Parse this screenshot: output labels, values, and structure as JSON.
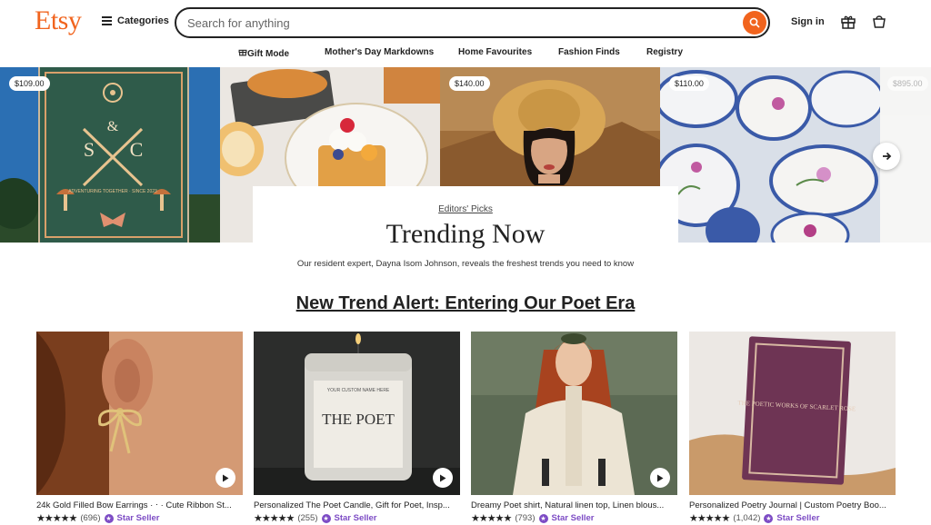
{
  "header": {
    "logo": "Etsy",
    "categories_label": "Categories",
    "search_placeholder": "Search for anything",
    "signin_label": "Sign in"
  },
  "nav": {
    "items": [
      {
        "label": "Gift Mode"
      },
      {
        "label": "Mother's Day Markdowns"
      },
      {
        "label": "Home Favourites"
      },
      {
        "label": "Fashion Finds"
      },
      {
        "label": "Registry"
      }
    ]
  },
  "hero": {
    "prices": [
      "$109.00",
      "$140.00",
      "$110.00",
      "$895.00"
    ],
    "eyebrow": "Editors' Picks",
    "title": "Trending Now",
    "description": "Our resident expert, Dayna Isom Johnson, reveals the freshest trends you need to know",
    "tapestry_text": "ADVENTURING TOGETHER · SINCE 2023"
  },
  "trend_heading": "New Trend Alert: Entering Our Poet Era",
  "products": [
    {
      "title": "24k Gold Filled Bow Earrings · ⋅ · Cute Ribbon St...",
      "stars": "★★★★★",
      "count": "(696)",
      "badge": "Star Seller"
    },
    {
      "title": "Personalized The Poet Candle, Gift for Poet, Insp...",
      "stars": "★★★★★",
      "count": "(255)",
      "badge": "Star Seller",
      "label_big": "THE POET",
      "label_top": "YOUR CUSTOM NAME HERE"
    },
    {
      "title": "Dreamy Poet shirt, Natural linen top, Linen blous...",
      "stars": "★★★★★",
      "count": "(793)",
      "badge": "Star Seller"
    },
    {
      "title": "Personalized Poetry Journal | Custom Poetry Boo...",
      "stars": "★★★★★",
      "count": "(1,042)",
      "badge": "Star Seller",
      "book_text": "THE POETIC WORKS OF SCARLET ROSE"
    }
  ],
  "colors": {
    "brand": "#f1641e",
    "star_seller": "#7d4cc5"
  }
}
